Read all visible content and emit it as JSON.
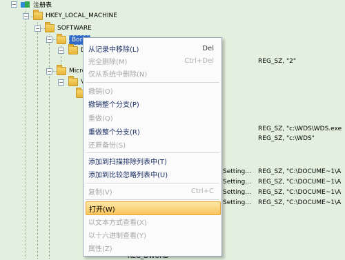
{
  "tree": {
    "root": "注册表",
    "hklm": "HKEY_LOCAL_MACHINE",
    "software": "SOFTWARE",
    "borland": "Borla",
    "d_child": "D",
    "microsoft": "Micro",
    "v_child": "V"
  },
  "values": {
    "row1": "REG_SZ, \"2\"",
    "row2": "REG_SZ, \"c:\\WDS\\WDS.exe",
    "row3": "REG_SZ, \"c:\\WDS\"",
    "row4_prefix": "Setting...",
    "row4": "REG_SZ, \"C:\\DOCUME~1\\A",
    "row5_prefix": "Setting...",
    "row5": "REG_SZ, \"C:\\DOCUME~1\\A",
    "row6_prefix": "Setting...",
    "row6": "REG_SZ, \"C:\\DOCUME~1\\A",
    "row7_prefix": "Setting...",
    "row7": "REG_SZ, \"C:\\DOCUME~1\\A",
    "bottom": "REG_DWORD"
  },
  "menu": {
    "remove_from_record": {
      "label": "从记录中移除(L)",
      "shortcut": "Del"
    },
    "delete_completely": {
      "label": "完全删除(M)",
      "shortcut": "Ctrl+Del"
    },
    "delete_from_system": {
      "label": "仅从系统中删除(N)"
    },
    "undo": {
      "label": "撤销(O)"
    },
    "undo_branch": {
      "label": "撤销整个分支(P)"
    },
    "redo": {
      "label": "重做(Q)"
    },
    "redo_branch": {
      "label": "重做整个分支(R)"
    },
    "restore_backup": {
      "label": "还原备份(S)"
    },
    "add_scan_exclude": {
      "label": "添加到扫描排除列表中(T)"
    },
    "add_compare_ignore": {
      "label": "添加到比较忽略列表中(U)"
    },
    "copy": {
      "label": "复制(V)",
      "shortcut": "Ctrl+C"
    },
    "open": {
      "label": "打开(W)"
    },
    "view_text": {
      "label": "以文本方式查看(X)"
    },
    "view_hex": {
      "label": "以十六进制查看(Y)"
    },
    "properties": {
      "label": "属性(Z)"
    }
  }
}
